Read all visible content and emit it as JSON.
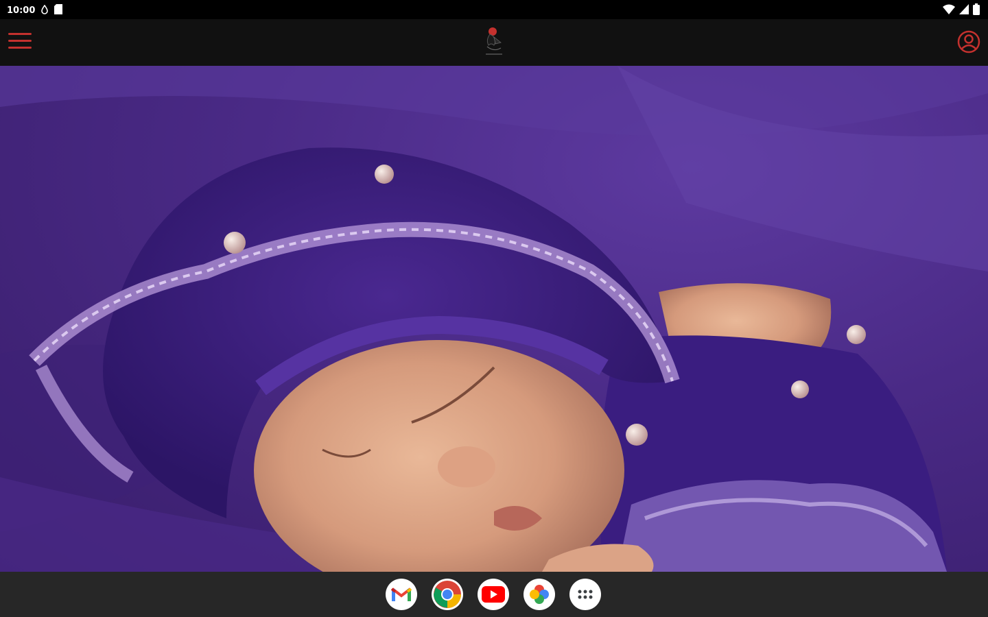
{
  "status_bar": {
    "time": "10:00",
    "left_icons": [
      "data-saver-icon",
      "sd-card-icon"
    ],
    "right_icons": [
      "wifi-icon",
      "cell-signal-icon",
      "battery-icon"
    ]
  },
  "app_bar": {
    "menu_icon": "hamburger-menu-icon",
    "logo_icon": "studio-logo-icon",
    "account_icon": "account-circle-icon",
    "accent_color": "#c4312e"
  },
  "hero": {
    "image": "newborn-in-purple-lace-bonnet-photo"
  },
  "taskbar": {
    "apps": [
      {
        "name": "gmail",
        "icon": "gmail-icon"
      },
      {
        "name": "chrome",
        "icon": "chrome-icon"
      },
      {
        "name": "youtube",
        "icon": "youtube-icon"
      },
      {
        "name": "photos",
        "icon": "photos-icon"
      },
      {
        "name": "app-drawer",
        "icon": "app-drawer-icon"
      }
    ]
  }
}
